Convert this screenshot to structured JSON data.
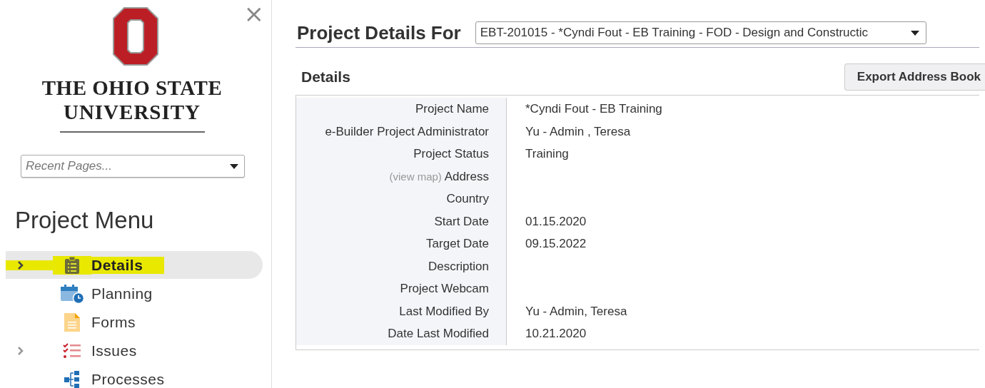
{
  "sidebar": {
    "logo": {
      "line_1": "THE OHIO STATE",
      "line_2": "UNIVERSITY"
    },
    "close": "×",
    "recent_pages": {
      "placeholder": "Recent Pages..."
    },
    "menu_title": "Project Menu",
    "menu": [
      {
        "label": "Details",
        "kind": "clipboard",
        "selected": true,
        "expandable": true
      },
      {
        "label": "Planning",
        "kind": "calendar",
        "selected": false,
        "expandable": false
      },
      {
        "label": "Forms",
        "kind": "document",
        "selected": false,
        "expandable": false
      },
      {
        "label": "Issues",
        "kind": "checklist",
        "selected": false,
        "expandable": true
      },
      {
        "label": "Processes",
        "kind": "flow",
        "selected": false,
        "expandable": false
      }
    ]
  },
  "main": {
    "title": "Project Details For",
    "project_select": {
      "value": "EBT-201015 - *Cyndi Fout - EB Training - FOD - Design and Constructic"
    },
    "section_title": "Details",
    "export_button": "Export Address Book",
    "rows": [
      {
        "label": "Project Name",
        "value": "*Cyndi Fout - EB Training"
      },
      {
        "label": "e-Builder Project Administrator",
        "value": "Yu - Admin , Teresa"
      },
      {
        "label": "Project Status",
        "value": "Training"
      },
      {
        "link": "(view map)",
        "label": "Address"
      },
      {
        "label": "Country"
      },
      {
        "label": "Start Date",
        "value": "01.15.2020"
      },
      {
        "label": "Target Date",
        "value": "09.15.2022"
      },
      {
        "label": "Description"
      },
      {
        "label": "Project Webcam"
      },
      {
        "label": "Last Modified By",
        "value": "Yu - Admin, Teresa"
      },
      {
        "label": "Date Last Modified",
        "value": "10.21.2020"
      }
    ]
  }
}
